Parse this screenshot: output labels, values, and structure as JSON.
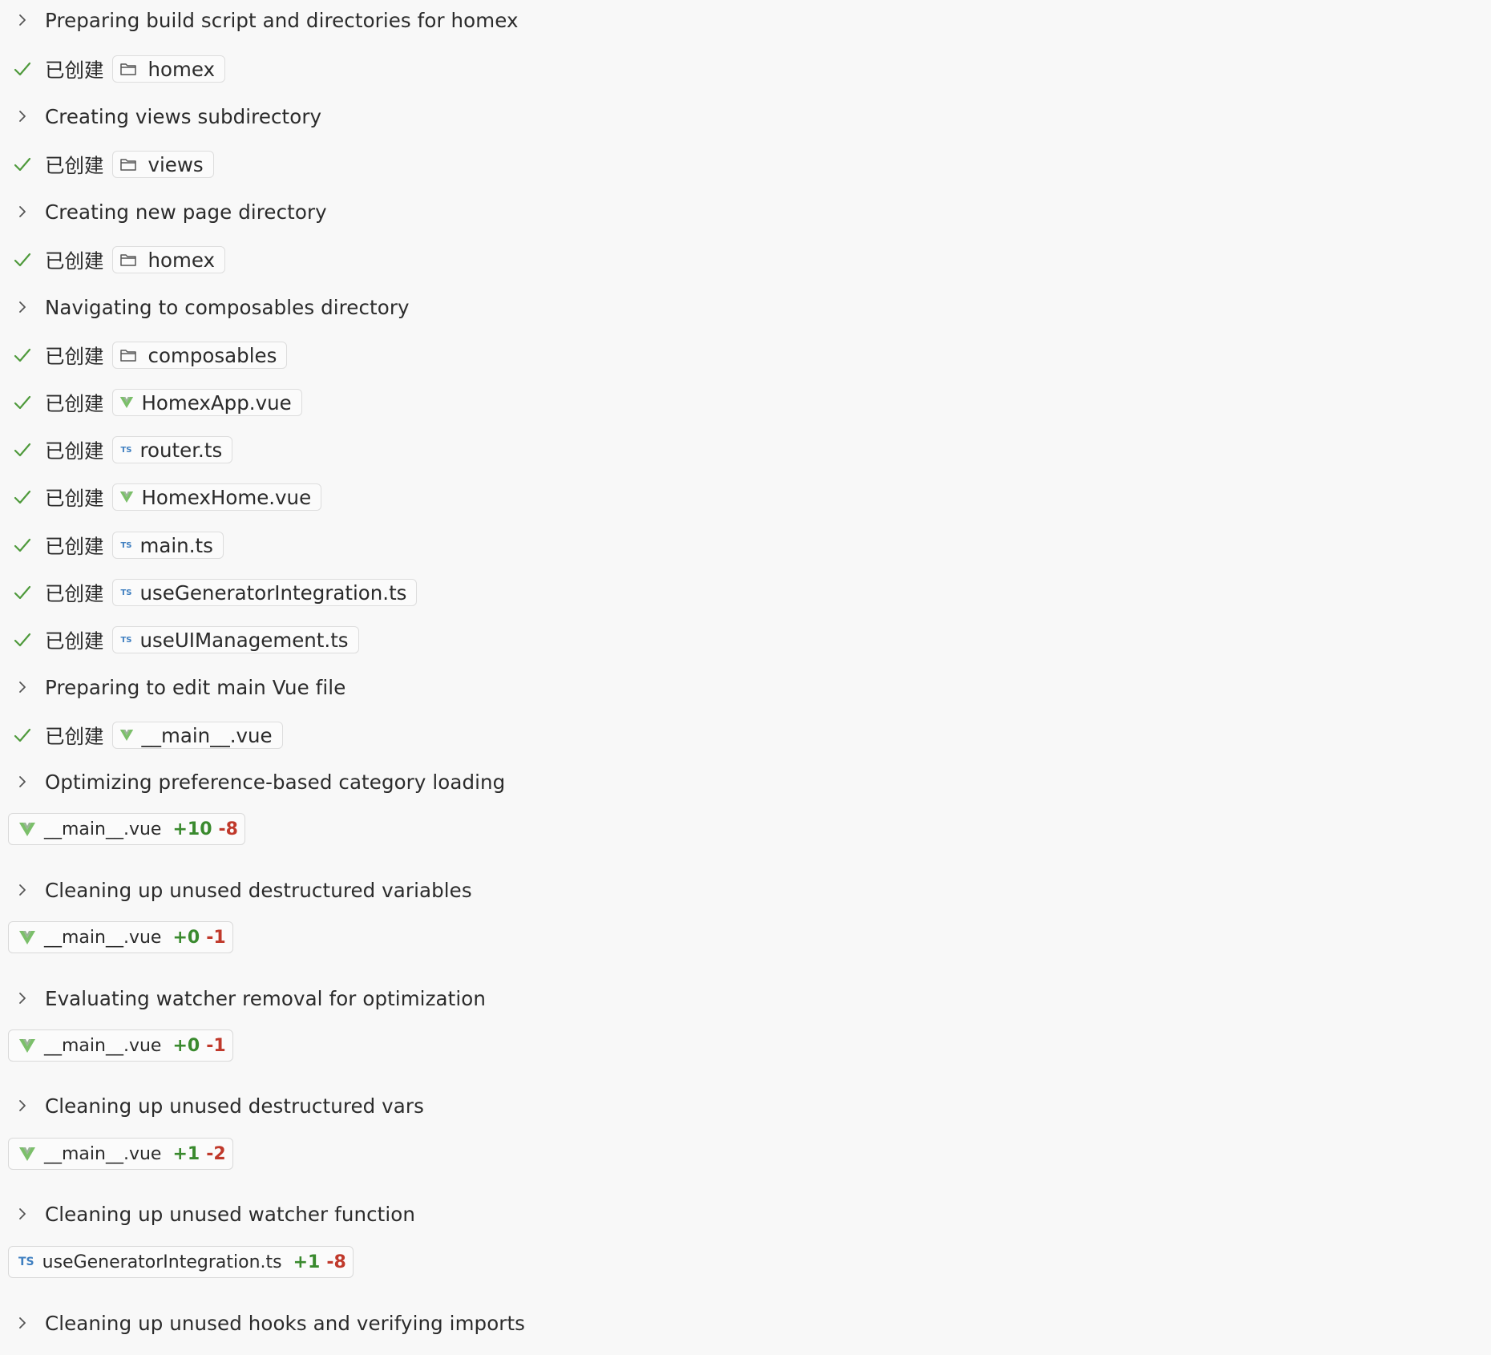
{
  "colors": {
    "background": "#f8f8f8",
    "check": "#4f9a3c",
    "added": "#3a8a2e",
    "removed": "#c0392b",
    "vue_icon": "#7bbf6a",
    "ts_icon": "#3f7fc0"
  },
  "created_word": "已创建",
  "rows": [
    {
      "type": "step",
      "label": "Preparing build script and directories for homex"
    },
    {
      "type": "created",
      "icon": "folder-icon",
      "name": "homex"
    },
    {
      "type": "step",
      "label": "Creating views subdirectory"
    },
    {
      "type": "created",
      "icon": "folder-icon",
      "name": "views"
    },
    {
      "type": "step",
      "label": "Creating new page directory"
    },
    {
      "type": "created",
      "icon": "folder-icon",
      "name": "homex"
    },
    {
      "type": "step",
      "label": "Navigating to composables directory"
    },
    {
      "type": "created",
      "icon": "folder-icon",
      "name": "composables"
    },
    {
      "type": "created",
      "icon": "vue-icon",
      "name": "HomexApp.vue"
    },
    {
      "type": "created",
      "icon": "ts-icon",
      "name": "router.ts"
    },
    {
      "type": "created",
      "icon": "vue-icon",
      "name": "HomexHome.vue"
    },
    {
      "type": "created",
      "icon": "ts-icon",
      "name": "main.ts"
    },
    {
      "type": "created",
      "icon": "ts-icon",
      "name": "useGeneratorIntegration.ts"
    },
    {
      "type": "created",
      "icon": "ts-icon",
      "name": "useUIManagement.ts"
    },
    {
      "type": "step",
      "label": "Preparing to edit main Vue file"
    },
    {
      "type": "created",
      "icon": "vue-icon",
      "name": "__main__.vue"
    },
    {
      "type": "step",
      "label": "Optimizing preference-based category loading"
    },
    {
      "type": "edit",
      "icon": "vue-icon",
      "name": "__main__.vue",
      "added": "+10",
      "removed": "-8"
    },
    {
      "type": "step",
      "label": "Cleaning up unused destructured variables"
    },
    {
      "type": "edit",
      "icon": "vue-icon",
      "name": "__main__.vue",
      "added": "+0",
      "removed": "-1"
    },
    {
      "type": "step",
      "label": "Evaluating watcher removal for optimization"
    },
    {
      "type": "edit",
      "icon": "vue-icon",
      "name": "__main__.vue",
      "added": "+0",
      "removed": "-1"
    },
    {
      "type": "step",
      "label": "Cleaning up unused destructured vars"
    },
    {
      "type": "edit",
      "icon": "vue-icon",
      "name": "__main__.vue",
      "added": "+1",
      "removed": "-2"
    },
    {
      "type": "step",
      "label": "Cleaning up unused watcher function"
    },
    {
      "type": "edit",
      "icon": "ts-icon",
      "name": "useGeneratorIntegration.ts",
      "added": "+1",
      "removed": "-8"
    },
    {
      "type": "step",
      "label": "Cleaning up unused hooks and verifying imports"
    }
  ]
}
